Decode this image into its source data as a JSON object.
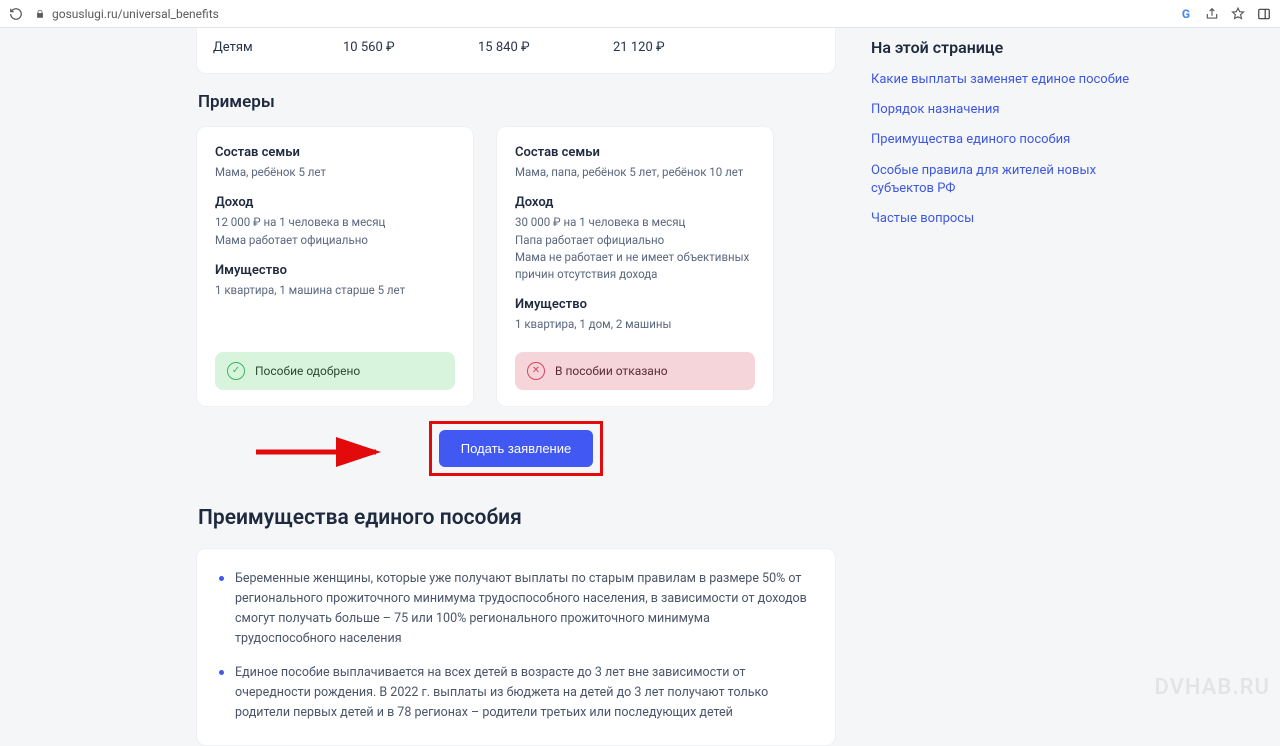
{
  "browser": {
    "url": "gosuslugi.ru/universal_benefits"
  },
  "table_row": {
    "label": "Детям",
    "v50": "10 560 ₽",
    "v75": "15 840 ₽",
    "v100": "21 120 ₽"
  },
  "examples_heading": "Примеры",
  "example_approved": {
    "family_title": "Состав семьи",
    "family_text": "Мама, ребёнок 5 лет",
    "income_title": "Доход",
    "income_line1": "12 000 ₽ на 1 человека в месяц",
    "income_line2": "Мама работает официально",
    "property_title": "Имущество",
    "property_text": "1 квартира, 1 машина старше 5 лет",
    "status": "Пособие одобрено"
  },
  "example_denied": {
    "family_title": "Состав семьи",
    "family_text": "Мама, папа, ребёнок 5 лет, ребёнок 10 лет",
    "income_title": "Доход",
    "income_line1": "30 000 ₽ на 1 человека в месяц",
    "income_line2": "Папа работает официально",
    "income_line3": "Мама не работает и не имеет объективных причин отсутствия дохода",
    "property_title": "Имущество",
    "property_text": "1 квартира, 1 дом, 2 машины",
    "status": "В пособии отказано"
  },
  "cta_label": "Подать заявление",
  "advantages_heading": "Преимущества единого пособия",
  "advantages": [
    "Беременные женщины, которые уже получают выплаты по старым правилам в размере 50% от регионального прожиточного минимума трудоспособного населения, в зависимости от доходов смогут получать больше – 75 или 100% регионального прожиточного минимума трудоспособного населения",
    "Единое пособие выплачивается на всех детей в возрасте до 3 лет вне зависимости от очередности рождения. В 2022 г. выплаты из бюджета на детей до 3 лет получают только родители первых детей и в 78 регионах – родители третьих или последующих детей"
  ],
  "sidebar": {
    "title": "На этой странице",
    "links": [
      "Какие выплаты заменяет единое пособие",
      "Порядок назначения",
      "Преимущества единого пособия",
      "Особые правила для жителей новых субъектов РФ",
      "Частые вопросы"
    ]
  },
  "watermark": "DVHAB.RU"
}
